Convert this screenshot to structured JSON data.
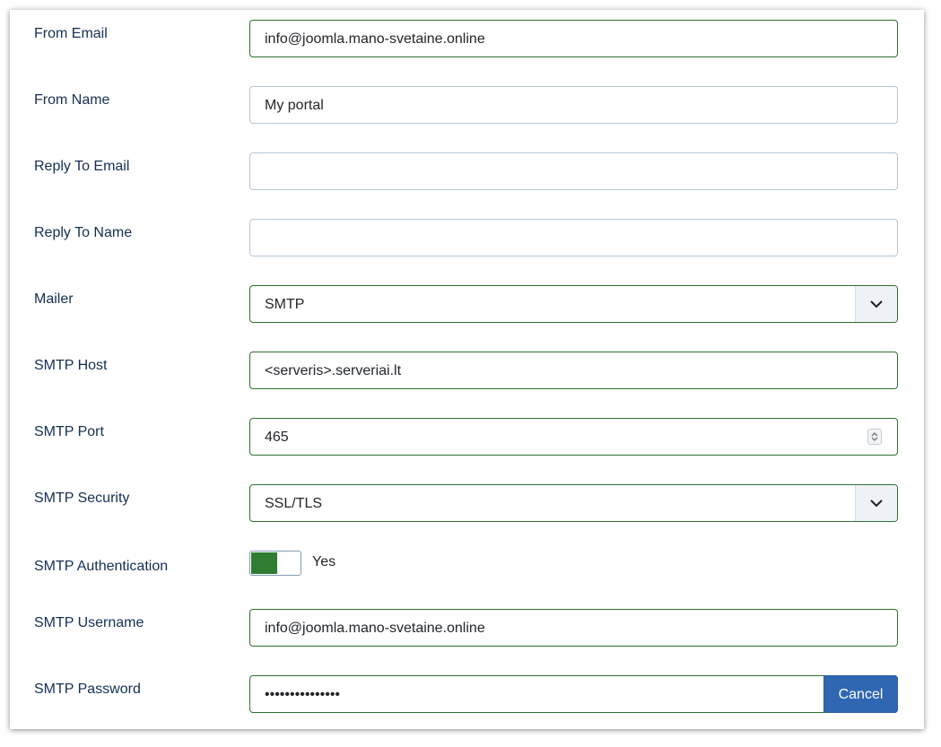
{
  "form": {
    "from_email": {
      "label": "From Email",
      "value": "info@joomla.mano-svetaine.online"
    },
    "from_name": {
      "label": "From Name",
      "value": "My portal"
    },
    "reply_to_email": {
      "label": "Reply To Email",
      "value": ""
    },
    "reply_to_name": {
      "label": "Reply To Name",
      "value": ""
    },
    "mailer": {
      "label": "Mailer",
      "value": "SMTP"
    },
    "smtp_host": {
      "label": "SMTP Host",
      "value": "<serveris>.serveriai.lt"
    },
    "smtp_port": {
      "label": "SMTP Port",
      "value": "465"
    },
    "smtp_security": {
      "label": "SMTP Security",
      "value": "SSL/TLS"
    },
    "smtp_auth": {
      "label": "SMTP Authentication",
      "value": "Yes",
      "on": true
    },
    "smtp_username": {
      "label": "SMTP Username",
      "value": "info@joomla.mano-svetaine.online"
    },
    "smtp_password": {
      "label": "SMTP Password",
      "value": "•••••••••••••••",
      "button_label": "Cancel"
    }
  },
  "colors": {
    "valid_border": "#2e7031",
    "toggle_on": "#2e7d32",
    "button": "#2f67b2"
  },
  "icons": {
    "select": "chevron-down-icon",
    "spinner": "up-down-arrows-icon"
  }
}
